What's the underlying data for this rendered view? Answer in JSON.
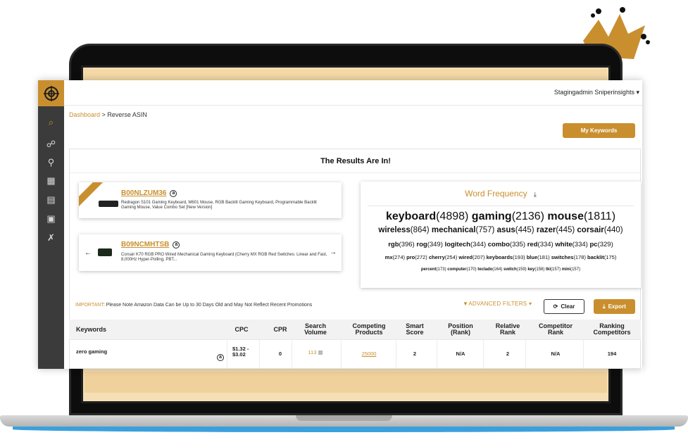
{
  "user": {
    "name": "Stagingadmin Sniperinsights"
  },
  "breadcrumb": {
    "link": "Dashboard",
    "separator": ">",
    "current": "Reverse ASIN"
  },
  "buttons": {
    "my_keywords": "My Keywords",
    "clear": "Clear",
    "export": "Export"
  },
  "results": {
    "title": "The Results Are In!"
  },
  "asins": [
    {
      "id": "B00NLZUM36",
      "description": "Redragon S101 Gaming Keyboard, M601 Mouse, RGB Backlit Gaming Keyboard, Programmable Backlit Gaming Mouse, Value Combo Set [New Version]"
    },
    {
      "id": "B09NCMHTSB",
      "description": "Corsair K70 RGB PRO Wired Mechanical Gaming Keyboard (Cherry MX RGB Red Switches: Linear and Fast, 8,000Hz Hyper-Polling, PBT..."
    }
  ],
  "word_frequency": {
    "title": "Word Frequency",
    "rows": [
      [
        [
          "keyboard",
          "(4898)"
        ],
        [
          "gaming",
          "(2136)"
        ],
        [
          "mouse",
          "(1811)"
        ]
      ],
      [
        [
          "wireless",
          "(864)"
        ],
        [
          "mechanical",
          "(757)"
        ],
        [
          "asus",
          "(445)"
        ],
        [
          "razer",
          "(445)"
        ],
        [
          "corsair",
          "(440)"
        ]
      ],
      [
        [
          "rgb",
          "(396)"
        ],
        [
          "rog",
          "(349)"
        ],
        [
          "logitech",
          "(344)"
        ],
        [
          "combo",
          "(335)"
        ],
        [
          "red",
          "(334)"
        ],
        [
          "white",
          "(334)"
        ],
        [
          "pc",
          "(329)"
        ]
      ],
      [
        [
          "mx",
          "(274)"
        ],
        [
          "pro",
          "(272)"
        ],
        [
          "cherry",
          "(254)"
        ],
        [
          "wired",
          "(207)"
        ],
        [
          "keyboards",
          "(193)"
        ],
        [
          "blue",
          "(181)"
        ],
        [
          "switches",
          "(178)"
        ],
        [
          "backlit",
          "(175)"
        ]
      ],
      [
        [
          "percent",
          "(173)"
        ],
        [
          "computer",
          "(170)"
        ],
        [
          "teclado",
          "(164)"
        ],
        [
          "switch",
          "(159)"
        ],
        [
          "key",
          "(158)"
        ],
        [
          "tkl",
          "(157)"
        ],
        [
          "mini",
          "(157)"
        ]
      ]
    ]
  },
  "notice": {
    "label": "IMPORTANT",
    "text": ": Please Note Amazon Data Can be Up to 30 Days Old and May Not Reflect Recent Promotions"
  },
  "filters": {
    "advanced": "ADVANCED FILTERS"
  },
  "table": {
    "headers": [
      "Keywords",
      "CPC",
      "CPR",
      "Search Volume",
      "Competing Products",
      "Smart Score",
      "Position (Rank)",
      "Relative Rank",
      "Competitor Rank",
      "Ranking Competitors"
    ],
    "rows": [
      {
        "keyword": "zero gaming",
        "cpc": "$1.32 - $3.02",
        "cpr": "0",
        "search_volume": "113",
        "competing_products": "25000",
        "smart_score": "2",
        "position_rank": "N/A",
        "relative_rank": "2",
        "competitor_rank": "N/A",
        "ranking_competitors": "194"
      }
    ]
  },
  "colors": {
    "accent": "#c98f2e",
    "sidebar": "#3b3b3b"
  }
}
